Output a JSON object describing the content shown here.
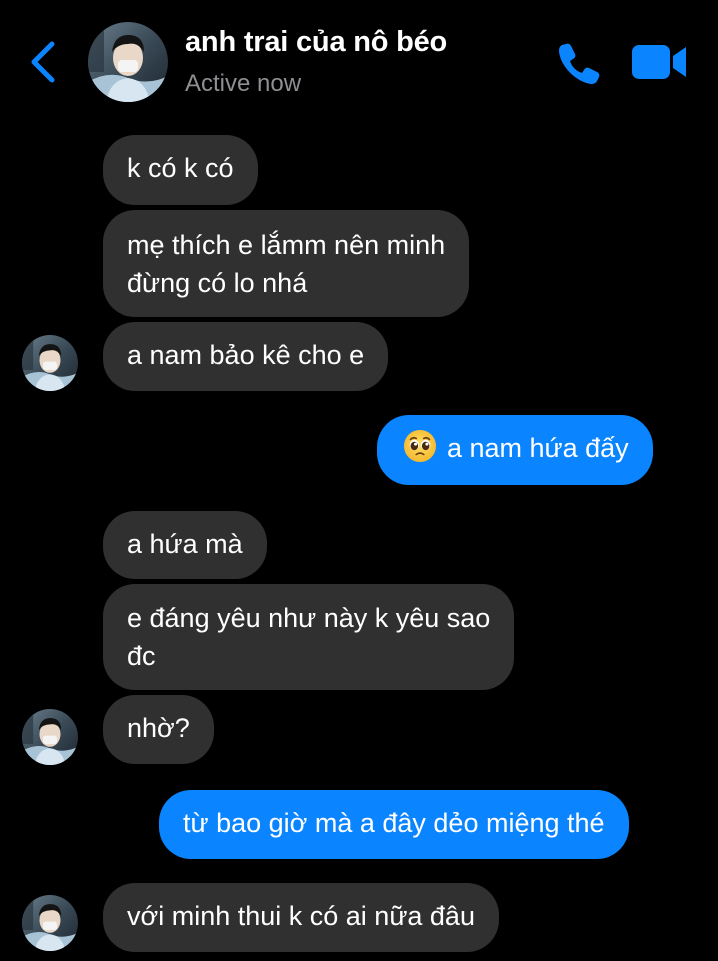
{
  "header": {
    "contact_name": "anh trai của nô béo",
    "status": "Active now",
    "accent_color": "#0a84ff"
  },
  "icons": {
    "back": "chevron-left-icon",
    "call": "phone-icon",
    "video": "video-camera-icon",
    "emoji": "pleading-face-emoji"
  },
  "colors": {
    "background": "#000000",
    "incoming_bubble": "#303030",
    "outgoing_bubble": "#0a84ff",
    "status_text": "#8e8e93"
  },
  "messages": [
    {
      "from": "them",
      "text": "k có k có"
    },
    {
      "from": "them",
      "lines": [
        "mẹ thích e lắmm nên minh",
        "đừng có lo nhá"
      ]
    },
    {
      "from": "them",
      "text": "a nam bảo kê cho e"
    },
    {
      "from": "me",
      "emoji": "pleading-face-emoji",
      "text": "a nam hứa đấy"
    },
    {
      "from": "them",
      "text": "a hứa mà"
    },
    {
      "from": "them",
      "lines": [
        "e đáng yêu như này k yêu sao",
        "đc"
      ]
    },
    {
      "from": "them",
      "text": "nhờ?"
    },
    {
      "from": "me",
      "text": "từ bao giờ mà a đây dẻo miệng thé"
    },
    {
      "from": "them",
      "text": "với minh thui k có ai nữa đâu"
    }
  ]
}
